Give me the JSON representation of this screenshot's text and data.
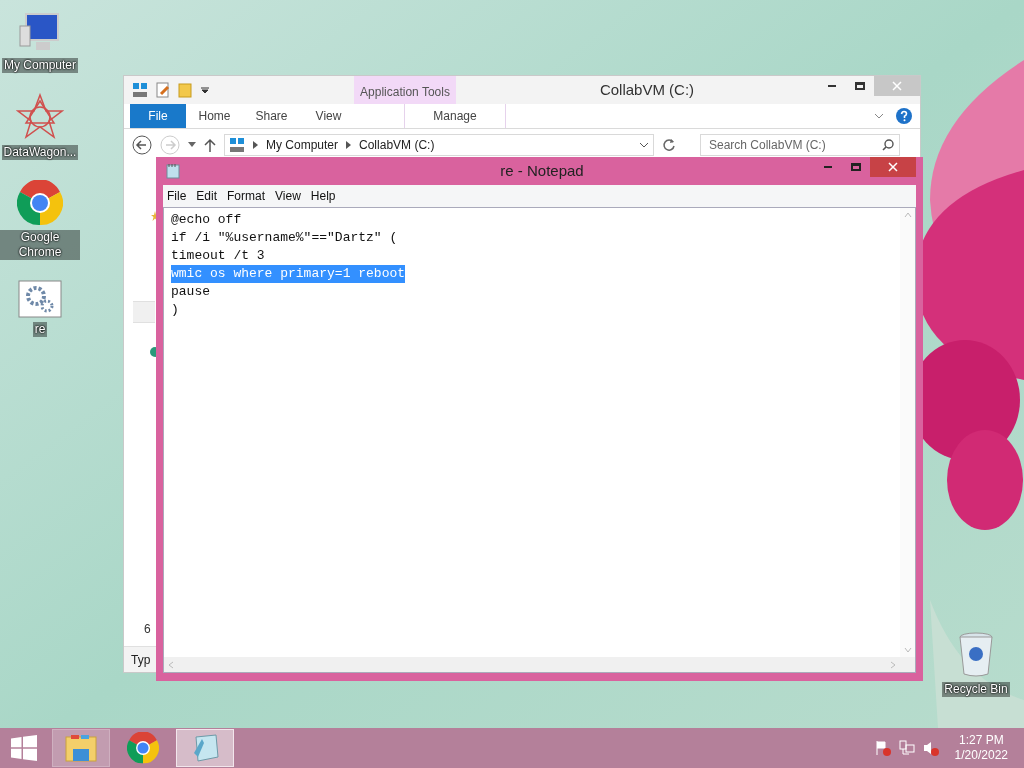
{
  "desktop_icons": [
    {
      "label": "My Computer",
      "kind": "computer"
    },
    {
      "label": "DataWagon...",
      "kind": "star"
    },
    {
      "label": "Google Chrome",
      "kind": "chrome"
    },
    {
      "label": "re",
      "kind": "settings"
    },
    {
      "label": "Recycle Bin",
      "kind": "bin"
    }
  ],
  "explorer": {
    "title": "CollabVM (C:)",
    "context_group": "Application Tools",
    "tabs": [
      {
        "label": "File",
        "kind": "file"
      },
      {
        "label": "Home",
        "kind": "normal"
      },
      {
        "label": "Share",
        "kind": "normal"
      },
      {
        "label": "View",
        "kind": "normal"
      },
      {
        "label": "Manage",
        "kind": "context"
      }
    ],
    "breadcrumbs": [
      "My Computer",
      "CollabVM (C:)"
    ],
    "search": {
      "placeholder": "Search CollabVM (C:)"
    },
    "status_text": "6",
    "column_header": "Typ"
  },
  "notepad": {
    "title": "re - Notepad",
    "menu": [
      "File",
      "Edit",
      "Format",
      "View",
      "Help"
    ],
    "lines": [
      {
        "text": "@echo off",
        "selected": false
      },
      {
        "text": "if /i \"%username%\"==\"Dartz\" (",
        "selected": false
      },
      {
        "text": "timeout /t 3",
        "selected": false
      },
      {
        "text": "wmic os where primary=1 reboot",
        "selected": true
      },
      {
        "text": "pause",
        "selected": false
      },
      {
        "text": ")",
        "selected": false
      }
    ]
  },
  "taskbar": {
    "items": [
      {
        "kind": "explorer",
        "selected": false
      },
      {
        "kind": "chrome",
        "selected": false
      },
      {
        "kind": "notepad",
        "selected": true
      }
    ],
    "time": "1:27 PM",
    "date": "1/20/2022"
  }
}
